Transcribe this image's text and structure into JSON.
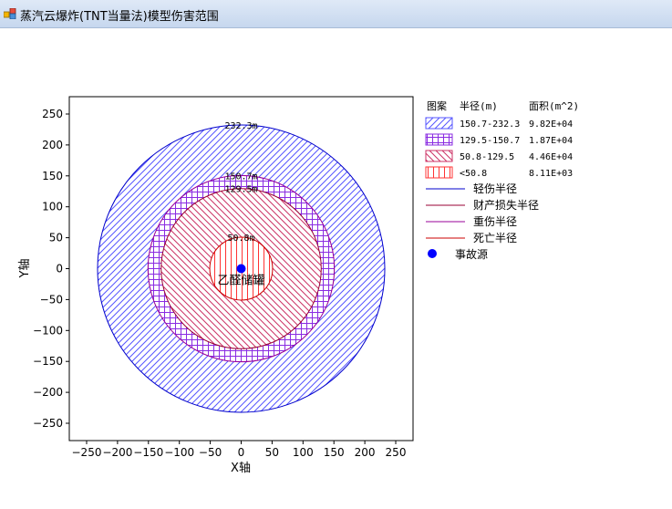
{
  "window": {
    "title": "蒸汽云爆炸(TNT当量法)模型伤害范围"
  },
  "chart_data": {
    "type": "area",
    "xlabel": "X轴",
    "ylabel": "Y轴",
    "xlim": [
      -278,
      278
    ],
    "ylim": [
      -278,
      278
    ],
    "xticks": [
      -250,
      -200,
      -150,
      -100,
      -50,
      0,
      50,
      100,
      150,
      200,
      250
    ],
    "yticks": [
      -250,
      -200,
      -150,
      -100,
      -50,
      0,
      50,
      100,
      150,
      200,
      250
    ],
    "grid": false,
    "legend_position": "right",
    "center": {
      "x": 0,
      "y": 0,
      "label": "乙醛储罐"
    },
    "rings": [
      {
        "radius": 232.3,
        "label": "232.3m",
        "outer_color": "#0000cc"
      },
      {
        "radius": 150.7,
        "label": "150.7m",
        "outer_color": "#990099"
      },
      {
        "radius": 129.5,
        "label": "129.5m",
        "outer_color": "#990033"
      },
      {
        "radius": 50.8,
        "label": "50.8m",
        "outer_color": "#cc0000"
      }
    ],
    "legend_header": {
      "pattern": "图案",
      "radius": "半径(m)",
      "area": "面积(m^2)"
    },
    "zones": [
      {
        "pattern": "diag-blue",
        "color": "#5555ff",
        "range": "150.7-232.3",
        "area": "9.82E+04"
      },
      {
        "pattern": "grid-purple",
        "color": "#8a2be2",
        "range": "129.5-150.7",
        "area": "1.87E+04"
      },
      {
        "pattern": "diag-red",
        "color": "#cc3366",
        "range": "50.8-129.5",
        "area": "4.46E+04"
      },
      {
        "pattern": "vert-red",
        "color": "#ff3333",
        "range": "<50.8",
        "area": "8.11E+03"
      }
    ],
    "lines": [
      {
        "label": "轻伤半径",
        "color": "#0000cc"
      },
      {
        "label": "财产损失半径",
        "color": "#990033"
      },
      {
        "label": "重伤半径",
        "color": "#990099"
      },
      {
        "label": "死亡半径",
        "color": "#cc0000"
      }
    ],
    "accident_point": {
      "label": "事故源",
      "color": "#0000ff"
    }
  }
}
